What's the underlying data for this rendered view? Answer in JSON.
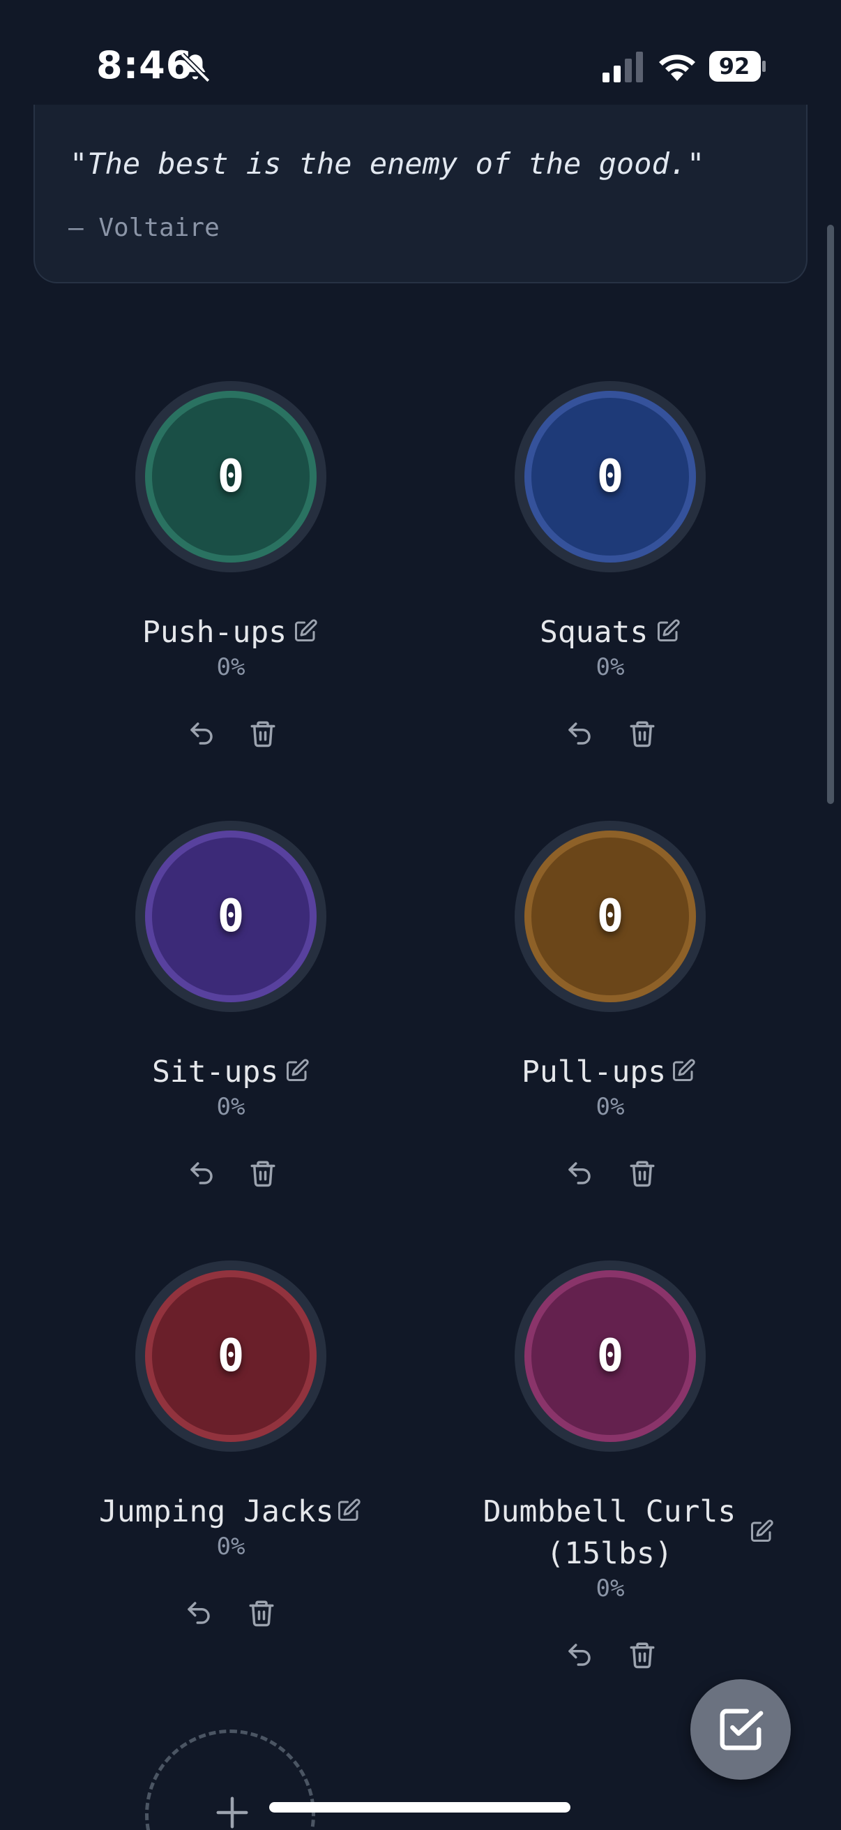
{
  "status_bar": {
    "time": "8:46",
    "battery": "92"
  },
  "quote": {
    "text": "\"The best is the enemy of the good.\"",
    "author": "— Voltaire"
  },
  "counters": [
    {
      "name": "Push-ups",
      "count": "0",
      "percent": "0%",
      "color": "#1a4f46"
    },
    {
      "name": "Squats",
      "count": "0",
      "percent": "0%",
      "color": "#1e3a78"
    },
    {
      "name": "Sit-ups",
      "count": "0",
      "percent": "0%",
      "color": "#3c2a78"
    },
    {
      "name": "Pull-ups",
      "count": "0",
      "percent": "0%",
      "color": "#6b4619"
    },
    {
      "name": "Jumping Jacks",
      "count": "0",
      "percent": "0%",
      "color": "#6a1f2a"
    },
    {
      "name": "Dumbbell Curls (15lbs)",
      "name_line1": "Dumbbell Curls",
      "name_line2": "(15lbs)",
      "count": "0",
      "percent": "0%",
      "color": "#64214e"
    }
  ],
  "icons": {
    "edit": "edit-icon",
    "undo": "undo-icon",
    "trash": "trash-icon",
    "add": "plus-icon",
    "fab": "checkbox-edit-icon"
  }
}
